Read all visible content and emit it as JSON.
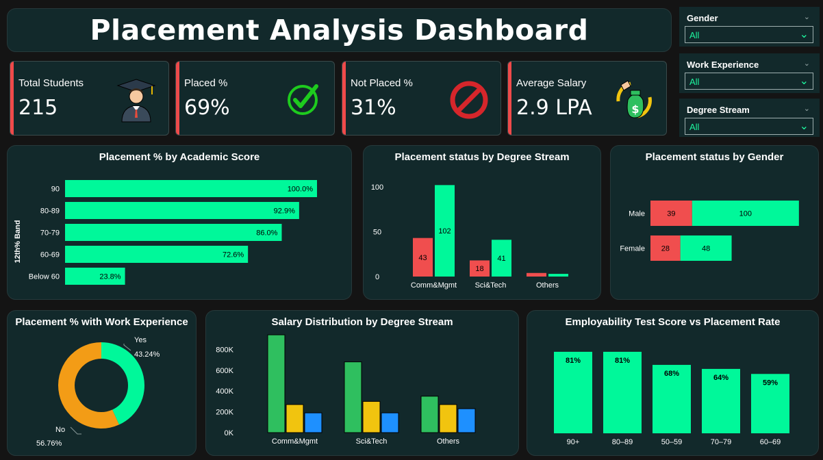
{
  "header": {
    "title": "Placement Analysis Dashboard"
  },
  "kpis": [
    {
      "label": "Total Students",
      "value": "215",
      "icon": "graduate-icon"
    },
    {
      "label": "Placed %",
      "value": "69%",
      "icon": "checkmark-icon"
    },
    {
      "label": "Not Placed %",
      "value": "31%",
      "icon": "prohibited-icon"
    },
    {
      "label": "Average Salary",
      "value": "2.9 LPA",
      "icon": "money-bag-icon"
    }
  ],
  "filters": [
    {
      "label": "Gender",
      "value": "All"
    },
    {
      "label": "Work Experience",
      "value": "All"
    },
    {
      "label": "Degree Stream",
      "value": "All"
    }
  ],
  "colors": {
    "accent_green": "#00f89a",
    "red": "#f04e4e",
    "orange": "#f39c16",
    "bar_green": "#2fbf5f",
    "bar_yellow": "#f1c40f",
    "bar_blue": "#1e90ff",
    "panel": "#12292b"
  },
  "chart_data": [
    {
      "id": "academic",
      "type": "bar",
      "orientation": "horizontal",
      "title": "Placement % by Academic Score",
      "ylabel": "12th% Band",
      "categories": [
        "90",
        "80-89",
        "70-79",
        "60-69",
        "Below 60"
      ],
      "values": [
        100.0,
        92.9,
        86.0,
        72.6,
        23.8
      ],
      "data_labels": [
        "100.0%",
        "92.9%",
        "86.0%",
        "72.6%",
        "23.8%"
      ]
    },
    {
      "id": "degree_status",
      "type": "bar",
      "title": "Placement status by Degree Stream",
      "categories": [
        "Comm&Mgmt",
        "Sci&Tech",
        "Others"
      ],
      "series": [
        {
          "values": [
            43,
            18,
            4
          ],
          "color": "#f04e4e"
        },
        {
          "values": [
            102,
            41,
            3
          ],
          "color": "#00f89a"
        }
      ],
      "ylim": [
        0,
        110
      ],
      "yticks": [
        "0",
        "50",
        "100"
      ]
    },
    {
      "id": "gender_status",
      "type": "bar",
      "orientation": "horizontal",
      "stacked": true,
      "title": "Placement status by Gender",
      "categories": [
        "Male",
        "Female"
      ],
      "series": [
        {
          "values": [
            39,
            28
          ],
          "color": "#f04e4e"
        },
        {
          "values": [
            100,
            48
          ],
          "color": "#00f89a"
        }
      ]
    },
    {
      "id": "work_exp",
      "type": "pie",
      "title": "Placement % with Work Experience",
      "labels": [
        "Yes",
        "No"
      ],
      "values": [
        43.24,
        56.76
      ],
      "value_labels": [
        "43.24%",
        "56.76%"
      ],
      "colors": [
        "#00f89a",
        "#f39c16"
      ]
    },
    {
      "id": "salary",
      "type": "bar",
      "title": "Salary Distribution by Degree Stream",
      "categories": [
        "Comm&Mgmt",
        "Sci&Tech",
        "Others"
      ],
      "series": [
        {
          "values": [
            940000,
            680000,
            350000
          ],
          "color": "#2fbf5f"
        },
        {
          "values": [
            270000,
            300000,
            270000
          ],
          "color": "#f1c40f"
        },
        {
          "values": [
            190000,
            190000,
            230000
          ],
          "color": "#1e90ff"
        }
      ],
      "ylim": [
        0,
        950000
      ],
      "yticks": [
        "0K",
        "200K",
        "400K",
        "600K",
        "800K"
      ]
    },
    {
      "id": "employability",
      "type": "bar",
      "title": "Employability Test Score vs Placement Rate",
      "categories": [
        "90+",
        "80–89",
        "50–59",
        "70–79",
        "60–69"
      ],
      "values": [
        81,
        81,
        68,
        64,
        59
      ],
      "data_labels": [
        "81%",
        "81%",
        "68%",
        "64%",
        "59%"
      ]
    }
  ]
}
